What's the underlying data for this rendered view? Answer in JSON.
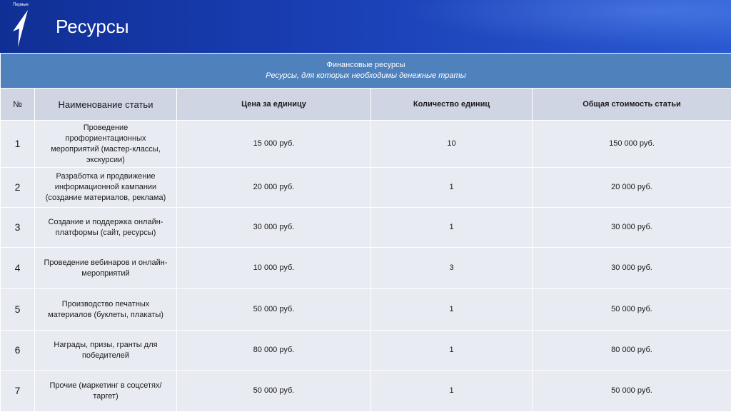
{
  "header": {
    "logo_text": "Первые",
    "title": "Ресурсы"
  },
  "table": {
    "section_title": "Финансовые ресурсы",
    "section_subtitle": "Ресурсы, для которых необходимы денежные траты",
    "columns": [
      "№",
      "Наименование статьи",
      "Цена за единицу",
      "Количество единиц",
      "Общая стоимость статьи"
    ],
    "rows": [
      {
        "num": "1",
        "name": "Проведение профориентационных мероприятий (мастер-классы, экскурсии)",
        "price": "15 000 руб.",
        "qty": "10",
        "total": "150 000 руб."
      },
      {
        "num": "2",
        "name": "Разработка и продвижение информационной кампании (создание материалов, реклама)",
        "price": "20 000 руб.",
        "qty": "1",
        "total": "20 000 руб."
      },
      {
        "num": "3",
        "name": "Создание и поддержка онлайн-платформы (сайт, ресурсы)",
        "price": "30 000 руб.",
        "qty": "1",
        "total": "30 000 руб."
      },
      {
        "num": "4",
        "name": "Проведение вебинаров и онлайн-мероприятий",
        "price": "10 000 руб.",
        "qty": "3",
        "total": "30 000 руб."
      },
      {
        "num": "5",
        "name": "Производство печатных материалов (буклеты, плакаты)",
        "price": "50 000 руб.",
        "qty": "1",
        "total": "50 000 руб."
      },
      {
        "num": "6",
        "name": "Награды, призы, гранты для победителей",
        "price": "80 000 руб.",
        "qty": "1",
        "total": "80 000 руб."
      },
      {
        "num": "7",
        "name": "Прочие (маркетинг в соцсетях/таргет)",
        "price": "50 000 руб.",
        "qty": "1",
        "total": "50 000 руб."
      }
    ]
  },
  "colors": {
    "header_blue": "#1a3fb5",
    "section_blue": "#4f81bd",
    "head_row": "#cfd5e3",
    "body_row": "#e9ebf2"
  }
}
